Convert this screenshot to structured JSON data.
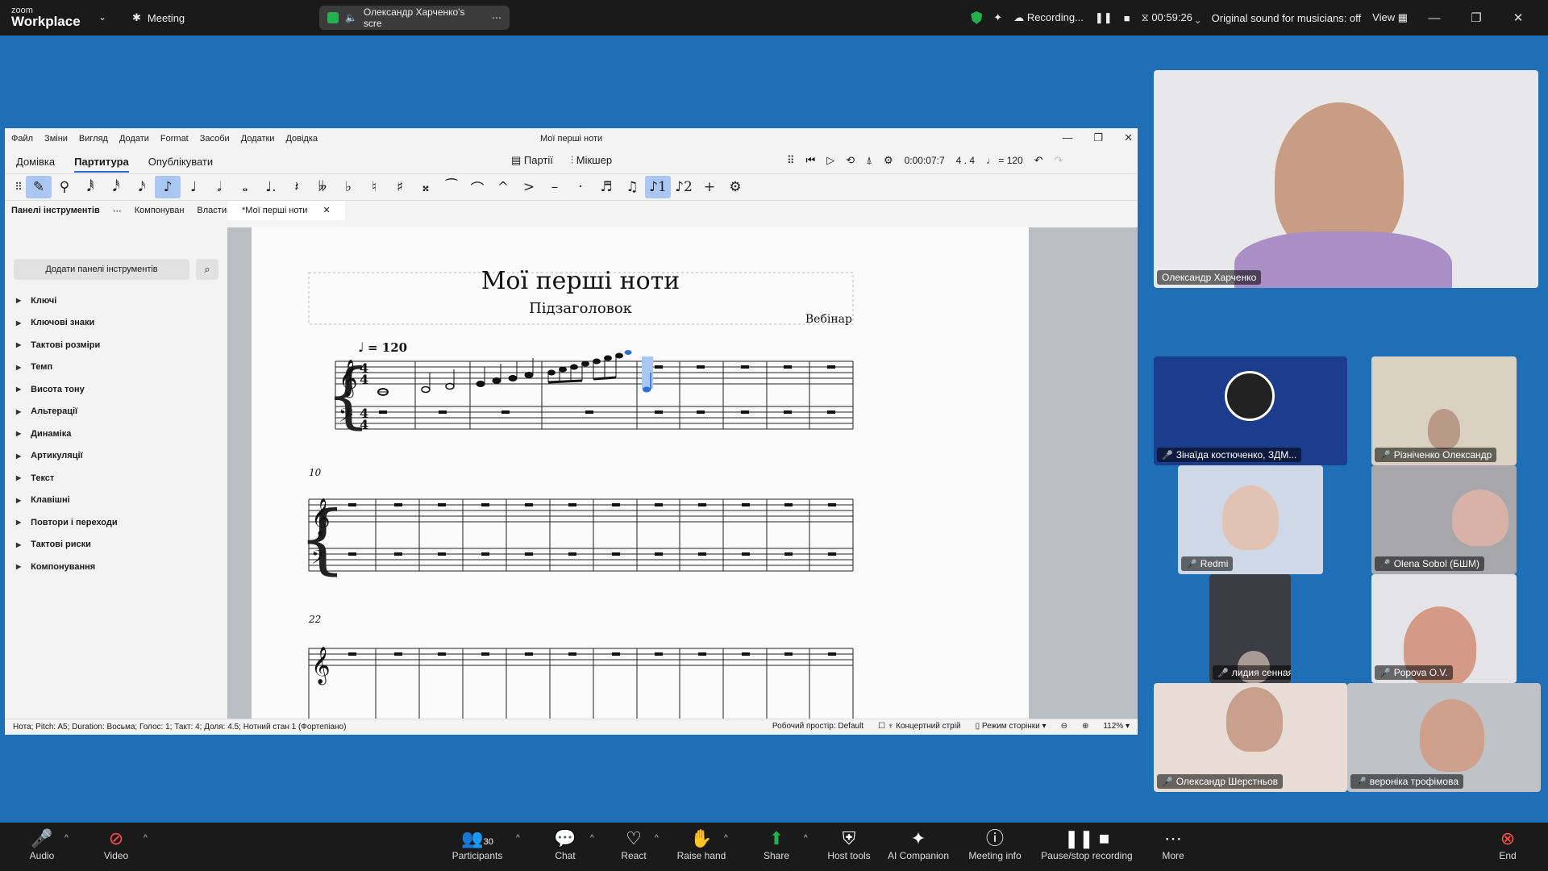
{
  "zoom": {
    "brand_line1": "zoom",
    "brand_line2": "Workplace",
    "meeting_label": "Meeting",
    "share_label": "Олександр Харченко's scre",
    "recording": "Recording...",
    "timer": "00:59:26",
    "original_sound": "Original sound for musicians: off",
    "view": "View",
    "participants_count": "30",
    "bottom": {
      "audio": "Audio",
      "video": "Video",
      "participants": "Participants",
      "chat": "Chat",
      "react": "React",
      "raise_hand": "Raise hand",
      "share": "Share",
      "host_tools": "Host tools",
      "ai_companion": "AI Companion",
      "meeting_info": "Meeting info",
      "pause_recording": "Pause/stop recording",
      "more": "More",
      "end": "End"
    }
  },
  "musescore": {
    "menu": [
      "Файл",
      "Зміни",
      "Вигляд",
      "Додати",
      "Format",
      "Засоби",
      "Додатки",
      "Довідка"
    ],
    "window_title": "Мої перші ноти",
    "tabs": [
      "Домівка",
      "Партитура",
      "Опублікувати"
    ],
    "parts": "Партії",
    "mixer": "Мікшер",
    "time": "0:00:07:7",
    "meter": "4 . 4",
    "tempo_display": "♩ = 120",
    "subtabs": [
      "Панелі інструментів",
      "Компонуван",
      "Властивос"
    ],
    "doc_tab": "*Мої перші ноти",
    "add_panels": "Додати панелі інструментів",
    "palettes": [
      "Ключі",
      "Ключові знаки",
      "Тактові розміри",
      "Темп",
      "Висота тону",
      "Альтерації",
      "Динаміка",
      "Артикуляції",
      "Текст",
      "Клавішні",
      "Повтори і переходи",
      "Тактові риски",
      "Компонування"
    ],
    "score_title": "Мої перші ноти",
    "score_subtitle": "Підзаголовок",
    "composer": "Вебінар",
    "tempo_mark": "= 120",
    "measure_10": "10",
    "measure_22": "22",
    "status": "Нота; Pitch: A5; Duration: Восьма; Голос: 1; Такт: 4; Доля: 4.5; Нотний стан 1 (Фортепіано)",
    "workspace": "Робочий простір: Default",
    "concert_pitch": "Концертний стрій",
    "page_mode": "Режим сторінки",
    "zoom": "112%"
  },
  "participants": [
    {
      "name": "Олександр Харченко"
    },
    {
      "name": "Зінаїда костюченко,  ЗДМ..."
    },
    {
      "name": "Різніченко Олександр"
    },
    {
      "name": "Redmi"
    },
    {
      "name": "Olena Sobol (БШМ)"
    },
    {
      "name": "лидия сенная"
    },
    {
      "name": "Popova O.V."
    },
    {
      "name": "Олександр Шерстньов"
    },
    {
      "name": "вероніка  трофімова"
    }
  ]
}
